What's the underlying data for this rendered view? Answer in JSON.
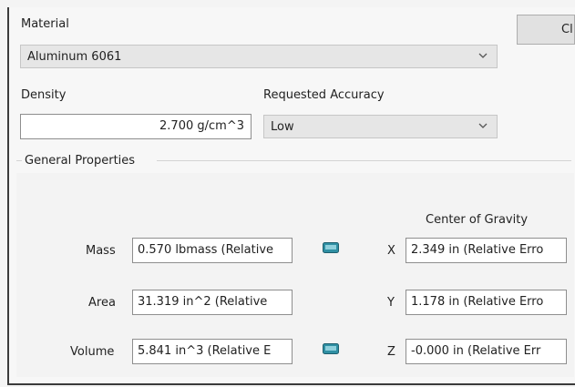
{
  "close_button_label": "Cl",
  "material": {
    "label": "Material",
    "selected": "Aluminum 6061"
  },
  "density": {
    "label": "Density",
    "value": "2.700 g/cm^3"
  },
  "accuracy": {
    "label": "Requested Accuracy",
    "selected": "Low"
  },
  "general": {
    "group_label": "General Properties",
    "center_of_gravity_label": "Center of Gravity",
    "rows": [
      {
        "label": "Mass",
        "value": "0.570 lbmass (Relative",
        "axis": "X",
        "cog": "2.349 in (Relative Erro"
      },
      {
        "label": "Area",
        "value": "31.319 in^2 (Relative",
        "axis": "Y",
        "cog": "1.178 in (Relative Erro"
      },
      {
        "label": "Volume",
        "value": "5.841 in^3 (Relative E",
        "axis": "Z",
        "cog": "-0.000 in (Relative Err"
      }
    ]
  },
  "colors": {
    "icon_teal": "#2f8fa3"
  },
  "icons": [
    "chevron-down-icon",
    "copy-icon"
  ]
}
